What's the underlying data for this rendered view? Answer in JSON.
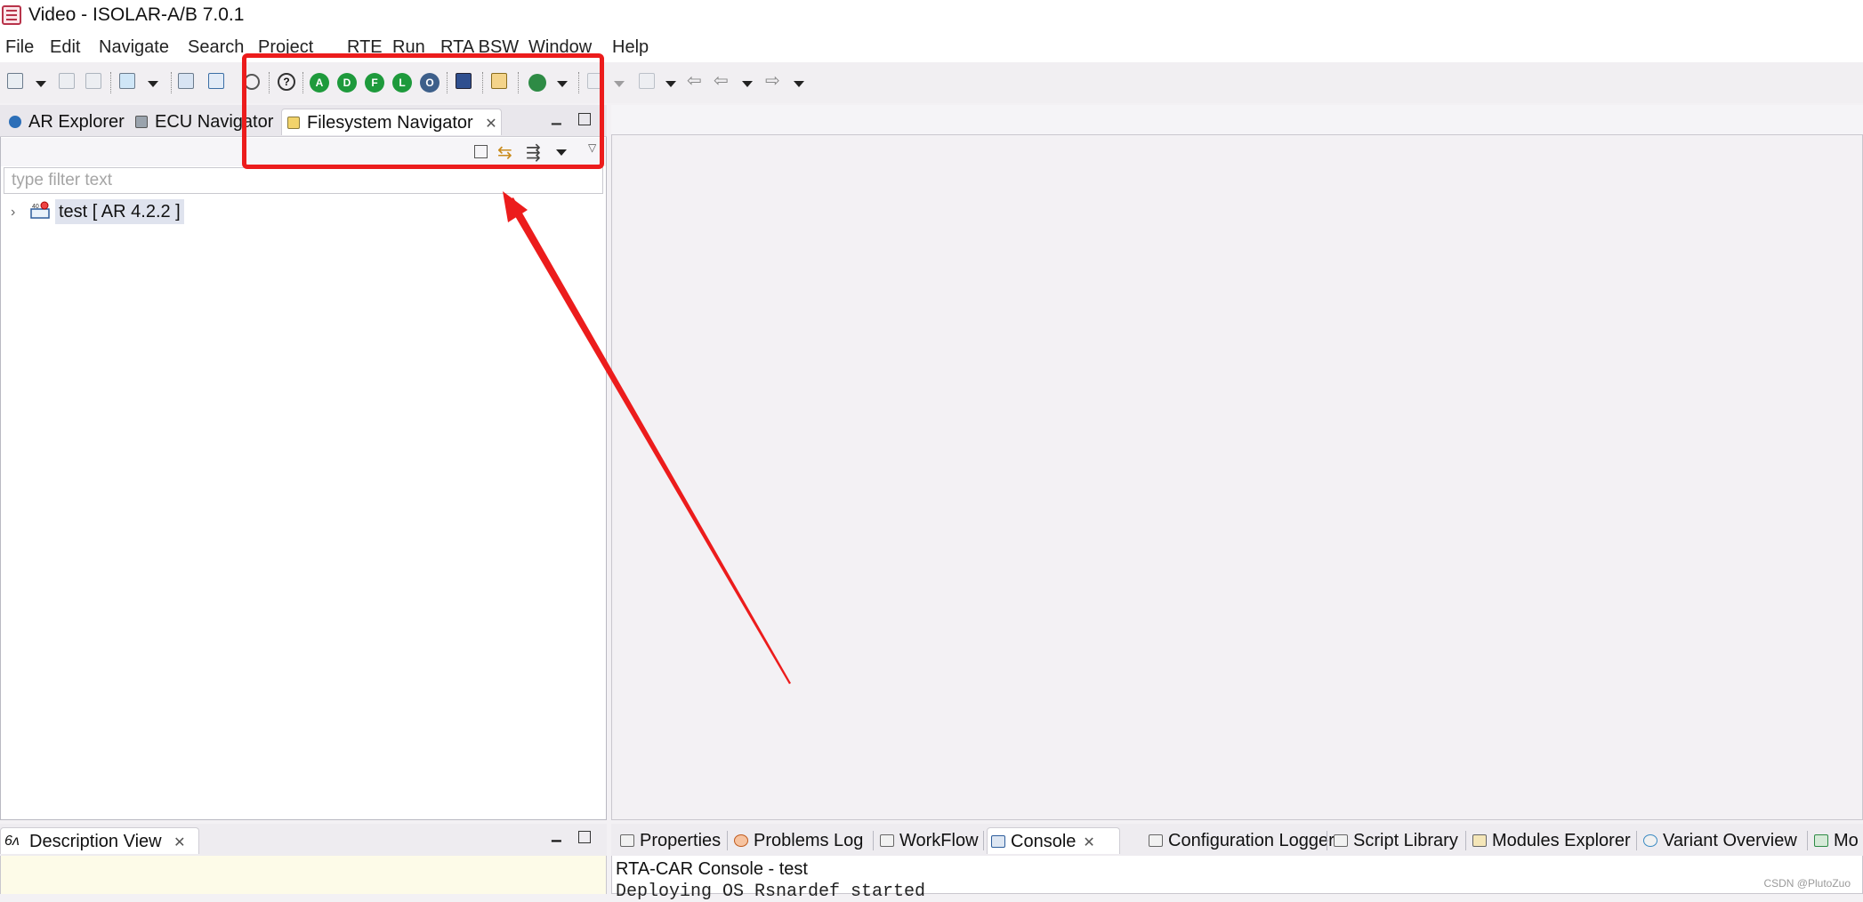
{
  "window": {
    "title": "Video - ISOLAR-A/B 7.0.1"
  },
  "menu": [
    "File",
    "Edit",
    "Navigate",
    "Search",
    "Project",
    "RTE",
    "Run",
    "RTA BSW",
    "Window",
    "Help"
  ],
  "toolbar": {
    "circle_buttons": [
      {
        "label": "A",
        "color": "#1e9a3c"
      },
      {
        "label": "D",
        "color": "#1e9a3c"
      },
      {
        "label": "F",
        "color": "#1e9a3c"
      },
      {
        "label": "L",
        "color": "#1e9a3c"
      },
      {
        "label": "O",
        "color": "#3d5f8a"
      }
    ]
  },
  "left_panel": {
    "tabs": [
      "AR Explorer",
      "ECU Navigator",
      "Filesystem Navigator"
    ],
    "active_tab": "Filesystem Navigator",
    "filter_placeholder": "type filter text",
    "tree": [
      {
        "label": "test [ AR 4.2.2 ]",
        "icon_text": "40"
      }
    ]
  },
  "bottom_left": {
    "tab": "Description View"
  },
  "bottom_right": {
    "tabs": [
      "Properties",
      "Problems Log",
      "WorkFlow",
      "Console",
      "Configuration Logger",
      "Script Library",
      "Modules Explorer",
      "Variant Overview",
      "Mo"
    ],
    "active_tab": "Console",
    "console_title": "RTA-CAR Console - test",
    "console_line": "Deploying OS Rsnardef started"
  },
  "annotation": {
    "color": "#ec1c1c"
  },
  "watermark": "CSDN @PlutoZuo"
}
